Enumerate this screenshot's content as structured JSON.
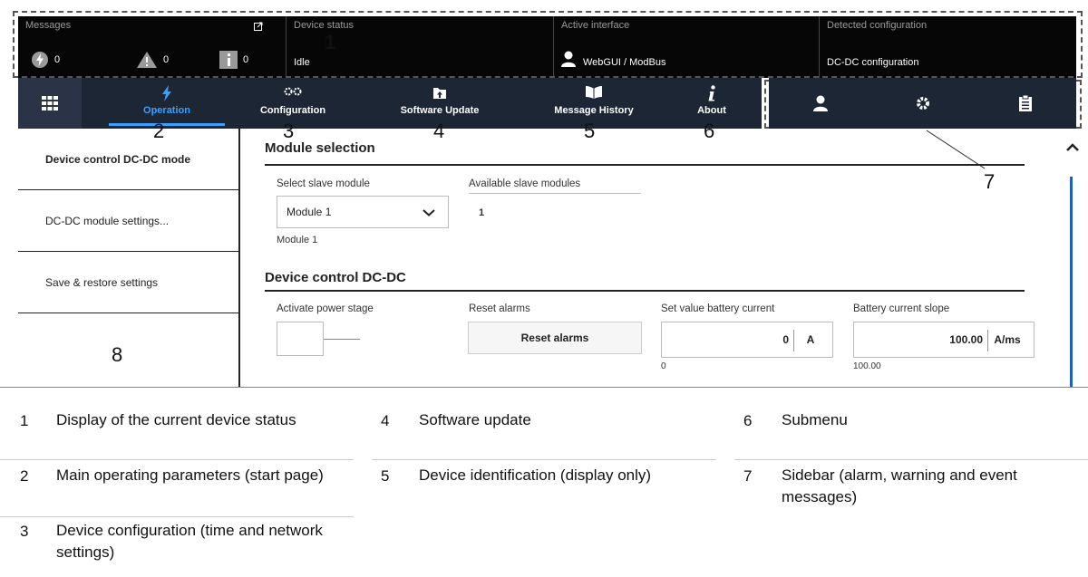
{
  "status_bar": {
    "messages_label": "Messages",
    "errors_count": "0",
    "warnings_count": "0",
    "info_count": "0",
    "device_status_label": "Device status",
    "device_status_value": "Idle",
    "active_interface_label": "Active interface",
    "active_interface_value": "WebGUI / ModBus",
    "detected_config_label": "Detected configuration",
    "detected_config_value": "DC-DC configuration"
  },
  "nav": {
    "items": [
      {
        "label": "Operation",
        "icon": "lightning-icon"
      },
      {
        "label": "Configuration",
        "icon": "gears-icon"
      },
      {
        "label": "Software Update",
        "icon": "upload-icon"
      },
      {
        "label": "Message History",
        "icon": "book-icon"
      },
      {
        "label": "About",
        "icon": "info-icon"
      }
    ],
    "active": "Operation"
  },
  "sidebar_buttons": [
    "user-icon",
    "gear-icon",
    "clipboard-icon"
  ],
  "submenu": {
    "items": [
      {
        "label": "Device control DC-DC mode",
        "active": true
      },
      {
        "label": "DC-DC module settings..."
      },
      {
        "label": "Save & restore settings"
      }
    ]
  },
  "module_selection": {
    "title": "Module selection",
    "select_label": "Select slave module",
    "select_value": "Module 1",
    "select_caption": "Module 1",
    "available_label": "Available slave modules",
    "available_value": "1"
  },
  "device_control": {
    "title": "Device control DC-DC",
    "power_stage_label": "Activate power stage",
    "reset_label": "Reset alarms",
    "reset_button": "Reset alarms",
    "battery_current_label": "Set value battery current",
    "battery_current_value": "0",
    "battery_current_unit": "A",
    "battery_current_caption": "0",
    "slope_label": "Battery current slope",
    "slope_value": "100.00",
    "slope_unit": "A/ms",
    "slope_caption": "100.00"
  },
  "callouts": [
    "1",
    "2",
    "3",
    "4",
    "5",
    "6",
    "7",
    "8"
  ],
  "legend": [
    {
      "num": "1",
      "text": "Display of the current device status"
    },
    {
      "num": "2",
      "text": "Main operating parameters (start page)"
    },
    {
      "num": "3",
      "text": "Device configuration (time and network settings)"
    },
    {
      "num": "4",
      "text": "Software update"
    },
    {
      "num": "5",
      "text": "Device identification (display only)"
    },
    {
      "num": "6",
      "text": "Submenu"
    },
    {
      "num": "7",
      "text": "Sidebar (alarm, warning and event messages)"
    }
  ],
  "colors": {
    "status_bg": "#060606",
    "nav_bg": "#1c2635",
    "accent": "#3aa0ff",
    "scrollbar": "#1f5fc0"
  }
}
